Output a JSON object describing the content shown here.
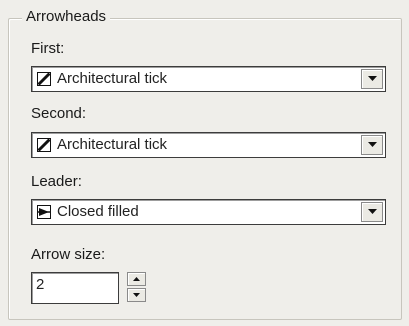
{
  "group": {
    "title": "Arrowheads"
  },
  "first": {
    "label": "First:",
    "value": "Architectural tick",
    "icon": "architectural-tick-icon"
  },
  "second": {
    "label": "Second:",
    "value": "Architectural tick",
    "icon": "architectural-tick-icon"
  },
  "leader": {
    "label": "Leader:",
    "value": "Closed filled",
    "icon": "closed-filled-arrow-icon"
  },
  "arrow_size": {
    "label": "Arrow size:",
    "value": "2"
  },
  "colors": {
    "background": "#efeeea",
    "field": "#ffffff",
    "border": "#3c3c3c"
  }
}
